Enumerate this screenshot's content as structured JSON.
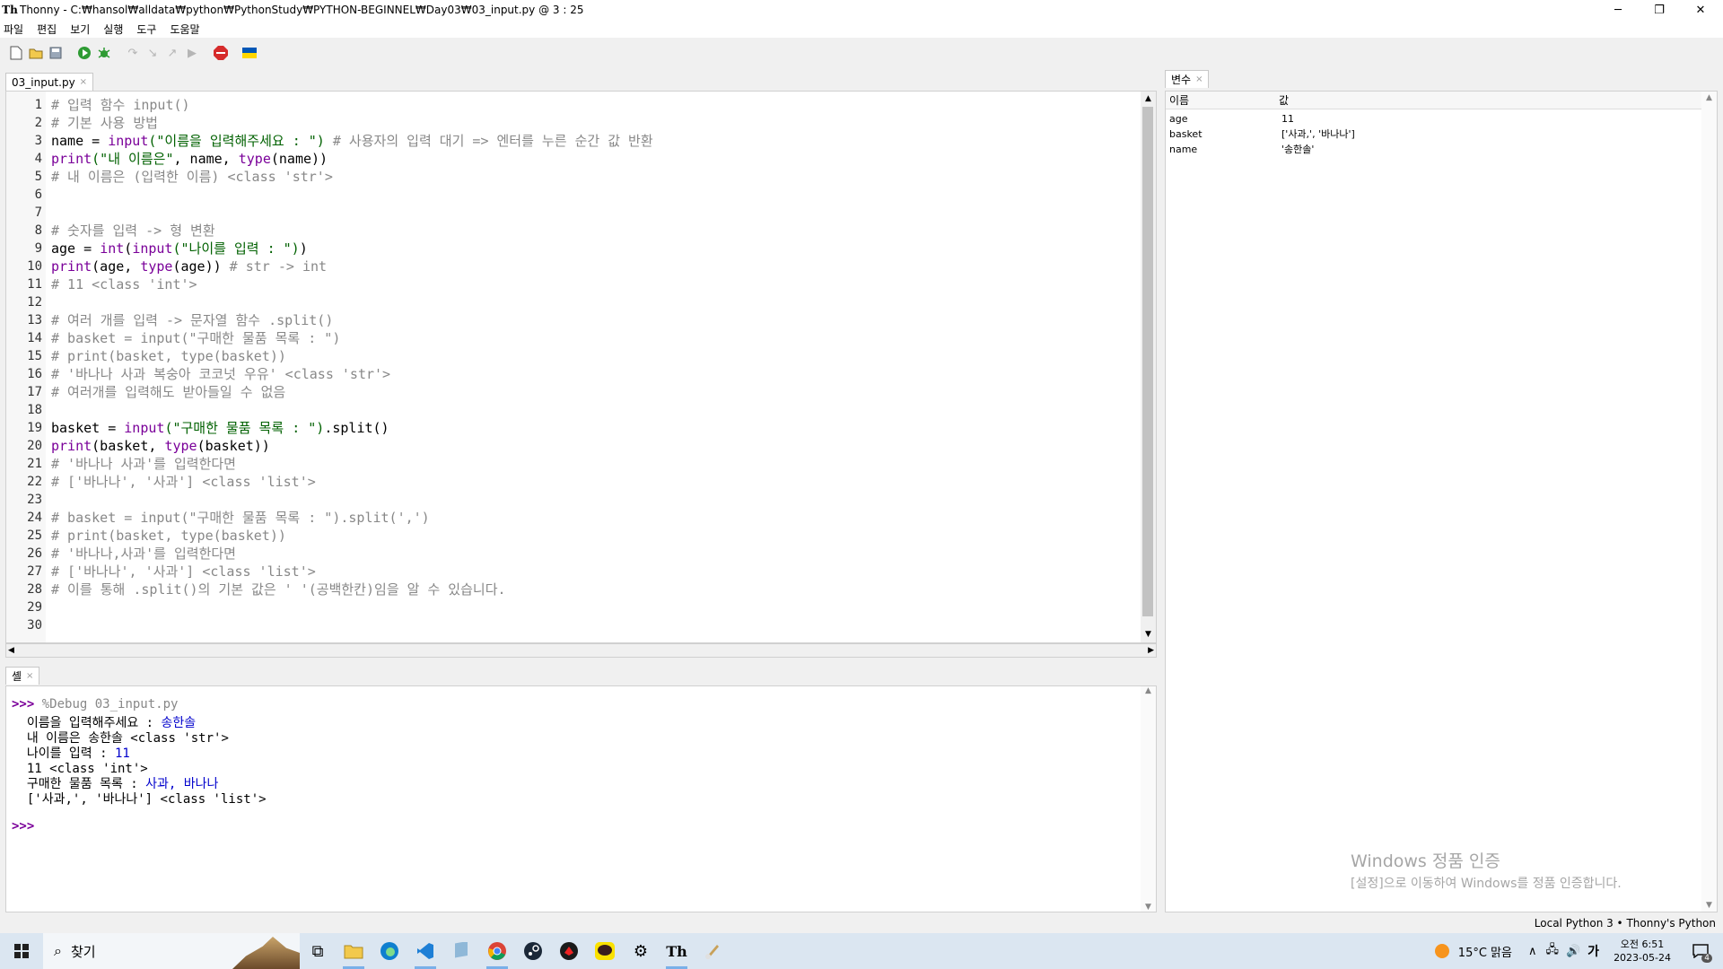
{
  "window": {
    "title": "Thonny  -  C:₩hansol₩alldata₩python₩PythonStudy₩PYTHON-BEGINNEL₩Day03₩03_input.py  @  3 : 25",
    "minimize": "─",
    "maximize": "❐",
    "close": "✕"
  },
  "menu": [
    "파일",
    "편집",
    "보기",
    "실행",
    "도구",
    "도움말"
  ],
  "editor": {
    "tab": "03_input.py",
    "line_numbers": [
      "1",
      "2",
      "3",
      "4",
      "5",
      "6",
      "7",
      "8",
      "9",
      "10",
      "11",
      "12",
      "13",
      "14",
      "15",
      "16",
      "17",
      "18",
      "19",
      "20",
      "21",
      "22",
      "23",
      "24",
      "25",
      "26",
      "27",
      "28",
      "29",
      "30"
    ],
    "lines": [
      [
        {
          "t": "# 입력 함수 input()",
          "c": "cm"
        }
      ],
      [
        {
          "t": "# 기본 사용 방법",
          "c": "cm"
        }
      ],
      [
        {
          "t": "name = "
        },
        {
          "t": "input",
          "c": "bi"
        },
        {
          "t": "(\"이름을 입력해주세요 : \")",
          "c": "st"
        },
        {
          "t": " # 사용자의 입력 대기 => 엔터를 누른 순간 값 반환",
          "c": "cm"
        }
      ],
      [
        {
          "t": "print",
          "c": "bi"
        },
        {
          "t": "(\"내 이름은\"",
          "c": "st"
        },
        {
          "t": ", name, "
        },
        {
          "t": "type",
          "c": "bi"
        },
        {
          "t": "(name))"
        }
      ],
      [
        {
          "t": "# 내 이름은 (입력한 이름) <class 'str'>",
          "c": "cm"
        }
      ],
      [],
      [],
      [
        {
          "t": "# 숫자를 입력 -> 형 변환",
          "c": "cm"
        }
      ],
      [
        {
          "t": "age = "
        },
        {
          "t": "int",
          "c": "bi"
        },
        {
          "t": "("
        },
        {
          "t": "input",
          "c": "bi"
        },
        {
          "t": "(\"나이를 입력 : \")",
          "c": "st"
        },
        {
          "t": ")"
        }
      ],
      [
        {
          "t": "print",
          "c": "bi"
        },
        {
          "t": "(age, "
        },
        {
          "t": "type",
          "c": "bi"
        },
        {
          "t": "(age))"
        },
        {
          "t": " # str -> int",
          "c": "cm"
        }
      ],
      [
        {
          "t": "# 11 <class 'int'>",
          "c": "cm"
        }
      ],
      [],
      [
        {
          "t": "# 여러 개를 입력 -> 문자열 함수 .split()",
          "c": "cm"
        }
      ],
      [
        {
          "t": "# basket = input(\"구매한 물품 목록 : \")",
          "c": "cm"
        }
      ],
      [
        {
          "t": "# print(basket, type(basket))",
          "c": "cm"
        }
      ],
      [
        {
          "t": "# '바나나 사과 복숭아 코코넛 우유' <class 'str'>",
          "c": "cm"
        }
      ],
      [
        {
          "t": "# 여러개를 입력해도 받아들일 수 없음",
          "c": "cm"
        }
      ],
      [],
      [
        {
          "t": "basket = "
        },
        {
          "t": "input",
          "c": "bi"
        },
        {
          "t": "(\"구매한 물품 목록 : \")",
          "c": "st"
        },
        {
          "t": ".split()"
        }
      ],
      [
        {
          "t": "print",
          "c": "bi"
        },
        {
          "t": "(basket, "
        },
        {
          "t": "type",
          "c": "bi"
        },
        {
          "t": "(basket))"
        }
      ],
      [
        {
          "t": "# '바나나 사과'를 입력한다면",
          "c": "cm"
        }
      ],
      [
        {
          "t": "# ['바나나', '사과'] <class 'list'>",
          "c": "cm"
        }
      ],
      [],
      [
        {
          "t": "# basket = input(\"구매한 물품 목록 : \").split(',')",
          "c": "cm"
        }
      ],
      [
        {
          "t": "# print(basket, type(basket))",
          "c": "cm"
        }
      ],
      [
        {
          "t": "# '바나나,사과'를 입력한다면",
          "c": "cm"
        }
      ],
      [
        {
          "t": "# ['바나나', '사과'] <class 'list'>",
          "c": "cm"
        }
      ],
      [
        {
          "t": "# 이를 통해 .split()의 기본 값은 ' '(공백한칸)임을 알 수 있습니다.",
          "c": "cm"
        }
      ],
      [],
      []
    ]
  },
  "shell": {
    "tab": "셸",
    "prompt": ">>>",
    "command": " %Debug 03_input.py",
    "output": [
      [
        {
          "t": "  이름을 입력해주세요 : "
        },
        {
          "t": "송한솔",
          "c": "ui"
        }
      ],
      [
        {
          "t": "  내 이름은 송한솔 <class 'str'>"
        }
      ],
      [
        {
          "t": "  나이를 입력 : "
        },
        {
          "t": "11",
          "c": "ui"
        }
      ],
      [
        {
          "t": "  11 <class 'int'>"
        }
      ],
      [
        {
          "t": "  구매한 물품 목록 : "
        },
        {
          "t": "사과, 바나나",
          "c": "ui"
        }
      ],
      [
        {
          "t": "  ['사과,', '바나나'] <class 'list'>"
        }
      ]
    ],
    "final_prompt": ">>>"
  },
  "variables": {
    "tab": "변수",
    "header_name": "이름",
    "header_value": "값",
    "rows": [
      {
        "name": "age",
        "value": "11"
      },
      {
        "name": "basket",
        "value": "['사과,', '바나나']"
      },
      {
        "name": "name",
        "value": "'송한솔'"
      }
    ]
  },
  "watermark": {
    "title": "Windows 정품 인증",
    "subtitle": "[설정]으로 이동하여 Windows를 정품 인증합니다."
  },
  "status": "Local Python 3  •  Thonny's Python",
  "taskbar": {
    "search": "찾기",
    "weather": "15°C  맑음",
    "ime": "가",
    "time": "오전 6:51",
    "date": "2023-05-24",
    "notif_count": "4"
  },
  "colors": {
    "accent": "#0078d7",
    "keyword": "#7a0099",
    "string": "#006100",
    "comment": "#888888"
  }
}
